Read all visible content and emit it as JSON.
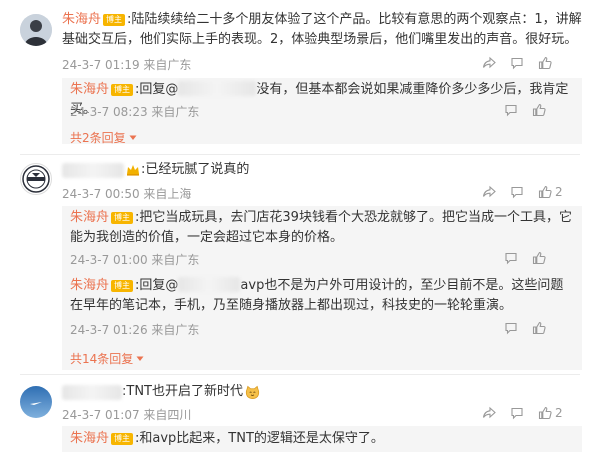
{
  "comment1": {
    "author": "朱海舟",
    "badge": "博主",
    "text": ":陆陆续续给二十多个朋友体验了这个产品。比较有意思的两个观察点：1，讲解基础交互后，他们实际上手的表现。2，体验典型场景后，他们嘴里发出的声音。很好玩。",
    "meta": "24-3-7 01:19 来自广东",
    "replies": [
      {
        "author": "朱海舟",
        "badge": "博主",
        "text_prefix": ":回复@",
        "text_rest": "没有，但基本都会说如果减重降价多少多少后，我肯定买。",
        "meta": "24-3-7 08:23 来自广东"
      }
    ],
    "more": "共2条回复"
  },
  "comment2": {
    "text": ":已经玩腻了说真的",
    "meta": "24-3-7 00:50 来自上海",
    "like_count": "2",
    "replies": [
      {
        "author": "朱海舟",
        "badge": "博主",
        "text": ":把它当成玩具，去门店花39块钱看个大恐龙就够了。把它当成一个工具，它能为我创造的价值，一定会超过它本身的价格。",
        "meta": "24-3-7 01:00 来自广东"
      },
      {
        "author": "朱海舟",
        "badge": "博主",
        "text_prefix": ":回复@",
        "text_rest": "avp也不是为户外可用设计的，至少目前不是。这些问题在早年的笔记本，手机，乃至随身播放器上都出现过，科技史的一轮轮重演。",
        "meta": "24-3-7 01:26 来自广东"
      }
    ],
    "more": "共14条回复"
  },
  "comment3": {
    "text": ":TNT也开启了新时代",
    "meta": "24-3-7 01:07 来自四川",
    "like_count": "2",
    "replies": [
      {
        "author": "朱海舟",
        "badge": "博主",
        "text": ":和avp比起来，TNT的逻辑还是太保守了。"
      }
    ]
  },
  "icons": [
    "share-icon",
    "comment-icon",
    "like-icon",
    "chevron-down-icon",
    "crown-icon",
    "cat-emoji-icon"
  ],
  "colors": {
    "name": "#eb7350",
    "badge": "#f7b500",
    "meta": "#999999",
    "reply_bg": "#f5f5f5"
  }
}
